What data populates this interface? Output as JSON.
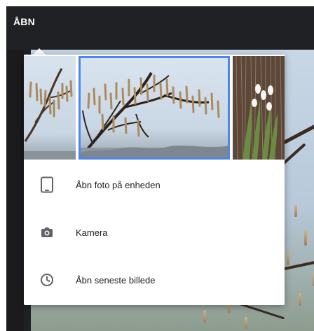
{
  "top_bar": {
    "open_label": "ÅBN"
  },
  "menu": {
    "items": [
      {
        "label": "Åbn foto på enheden",
        "icon": "tablet-icon"
      },
      {
        "label": "Kamera",
        "icon": "camera-icon"
      },
      {
        "label": "Åbn seneste billede",
        "icon": "clock-icon"
      }
    ]
  },
  "colors": {
    "topbar_bg": "#202124",
    "selection_border": "#4f86ec",
    "icon_gray": "#5f6368"
  }
}
